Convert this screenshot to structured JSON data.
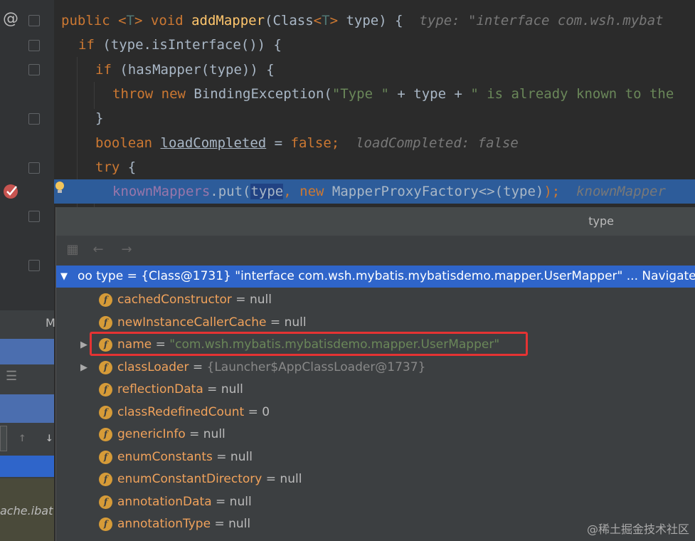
{
  "editor": {
    "lines": [
      {
        "indent": "",
        "parts": [
          {
            "t": "public ",
            "c": "kw"
          },
          {
            "t": "<",
            "c": "kw"
          },
          {
            "t": "T",
            "c": "tp"
          },
          {
            "t": "> ",
            "c": "kw"
          },
          {
            "t": "void ",
            "c": "kw"
          },
          {
            "t": "addMapper",
            "c": "mth"
          },
          {
            "t": "(Class",
            "c": ""
          },
          {
            "t": "<",
            "c": "kw"
          },
          {
            "t": "T",
            "c": "tp"
          },
          {
            "t": "> ",
            "c": "kw"
          },
          {
            "t": "type) {",
            "c": ""
          },
          {
            "t": "  type: \"interface com.wsh.mybat",
            "c": "hint"
          }
        ]
      },
      {
        "indent": "  ",
        "parts": [
          {
            "t": "if ",
            "c": "kw"
          },
          {
            "t": "(type.isInterface()) {",
            "c": ""
          }
        ]
      },
      {
        "indent": "    ",
        "parts": [
          {
            "t": "if ",
            "c": "kw"
          },
          {
            "t": "(hasMapper(type)) {",
            "c": ""
          }
        ]
      },
      {
        "indent": "      ",
        "parts": [
          {
            "t": "throw new ",
            "c": "kw"
          },
          {
            "t": "BindingException(",
            "c": ""
          },
          {
            "t": "\"Type \"",
            "c": "str"
          },
          {
            "t": " + type + ",
            "c": ""
          },
          {
            "t": "\" is already known to the",
            "c": "str"
          }
        ]
      },
      {
        "indent": "    ",
        "parts": [
          {
            "t": "}",
            "c": ""
          }
        ]
      },
      {
        "indent": "    ",
        "parts": [
          {
            "t": "boolean ",
            "c": "kw"
          },
          {
            "t": "loadCompleted",
            "c": "ul"
          },
          {
            "t": " = ",
            "c": ""
          },
          {
            "t": "false",
            "c": "kw"
          },
          {
            "t": ";",
            "c": "kw"
          },
          {
            "t": "  loadCompleted: false",
            "c": "hint"
          }
        ]
      },
      {
        "indent": "    ",
        "parts": [
          {
            "t": "try ",
            "c": "kw"
          },
          {
            "t": "{",
            "c": ""
          }
        ]
      },
      {
        "indent": "      ",
        "parts": [
          {
            "t": "knownMappers",
            "c": "fld"
          },
          {
            "t": ".put(",
            "c": ""
          },
          {
            "t": "type",
            "c": "sel"
          },
          {
            "t": ", ",
            "c": "kw"
          },
          {
            "t": "new ",
            "c": "kw"
          },
          {
            "t": "MapperProxyFactory<>(type)",
            "c": ""
          },
          {
            "t": ");",
            "c": "kw"
          },
          {
            "t": "  knownMapper",
            "c": "hint"
          }
        ]
      }
    ],
    "at_symbol": "@"
  },
  "popup": {
    "title": "type",
    "root": {
      "label": "oo type = {Class@1731} \"interface com.wsh.mybatis.mybatisdemo.mapper.UserMapper\" ... Navigate"
    },
    "fields": [
      {
        "name": "cachedConstructor",
        "eq": " = ",
        "value": "null",
        "vtype": "plain",
        "expand": false
      },
      {
        "name": "newInstanceCallerCache",
        "eq": " = ",
        "value": "null",
        "vtype": "plain",
        "expand": false
      },
      {
        "name": "name",
        "eq": " = ",
        "value": "\"com.wsh.mybatis.mybatisdemo.mapper.UserMapper\"",
        "vtype": "str",
        "expand": true
      },
      {
        "name": "classLoader",
        "eq": " = ",
        "value": "{Launcher$AppClassLoader@1737}",
        "vtype": "ref",
        "expand": true
      },
      {
        "name": "reflectionData",
        "eq": " = ",
        "value": "null",
        "vtype": "plain",
        "expand": false
      },
      {
        "name": "classRedefinedCount",
        "eq": " = ",
        "value": "0",
        "vtype": "plain",
        "expand": false
      },
      {
        "name": "genericInfo",
        "eq": " = ",
        "value": "null",
        "vtype": "plain",
        "expand": false
      },
      {
        "name": "enumConstants",
        "eq": " = ",
        "value": "null",
        "vtype": "plain",
        "expand": false
      },
      {
        "name": "enumConstantDirectory",
        "eq": " = ",
        "value": "null",
        "vtype": "plain",
        "expand": false
      },
      {
        "name": "annotationData",
        "eq": " = ",
        "value": "null",
        "vtype": "plain",
        "expand": false
      },
      {
        "name": "annotationType",
        "eq": " = ",
        "value": "null",
        "vtype": "plain",
        "expand": false
      }
    ],
    "field_icon": "f"
  },
  "sidebar_fragments": {
    "letter": "M",
    "file_hint": "ache.ibat"
  },
  "watermark": "@稀土掘金技术社区"
}
